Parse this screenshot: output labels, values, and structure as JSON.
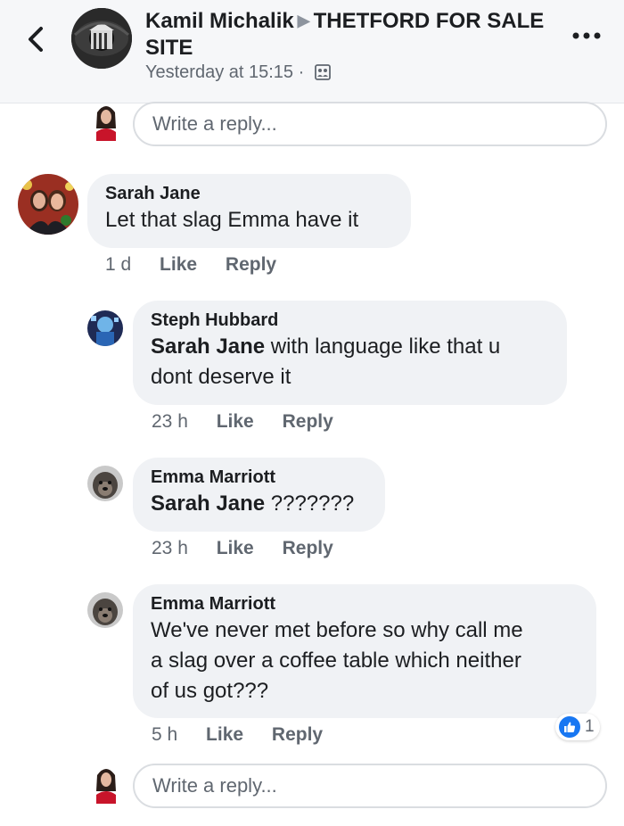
{
  "header": {
    "author": "Kamil Michalik",
    "group": "THETFORD FOR SALE SITE",
    "timestamp": "Yesterday at 15:15",
    "separator": "·"
  },
  "reply_box_top": {
    "placeholder": "Write a reply..."
  },
  "comments": [
    {
      "author": "Sarah Jane",
      "text": "Let that slag Emma have it",
      "time": "1 d",
      "like": "Like",
      "reply": "Reply"
    },
    {
      "author": "Steph Hubbard",
      "mention": "Sarah Jane",
      "text_line1": " with language like that u",
      "text_line2": "dont deserve it",
      "time": "23 h",
      "like": "Like",
      "reply": "Reply"
    },
    {
      "author": "Emma Marriott",
      "mention": "Sarah Jane",
      "text": " ???????",
      "time": "23 h",
      "like": "Like",
      "reply": "Reply"
    },
    {
      "author": "Emma Marriott",
      "text_line1": "We've never met before so why call me",
      "text_line2": "a slag over a coffee table which neither",
      "text_line3": "of us got???",
      "time": "5 h",
      "like": "Like",
      "reply": "Reply",
      "reaction_count": "1"
    }
  ],
  "reply_box_bottom": {
    "placeholder": "Write a reply..."
  },
  "colors": {
    "bubble": "#f0f2f5",
    "like_blue": "#1877f2",
    "secondary_text": "#606770"
  }
}
